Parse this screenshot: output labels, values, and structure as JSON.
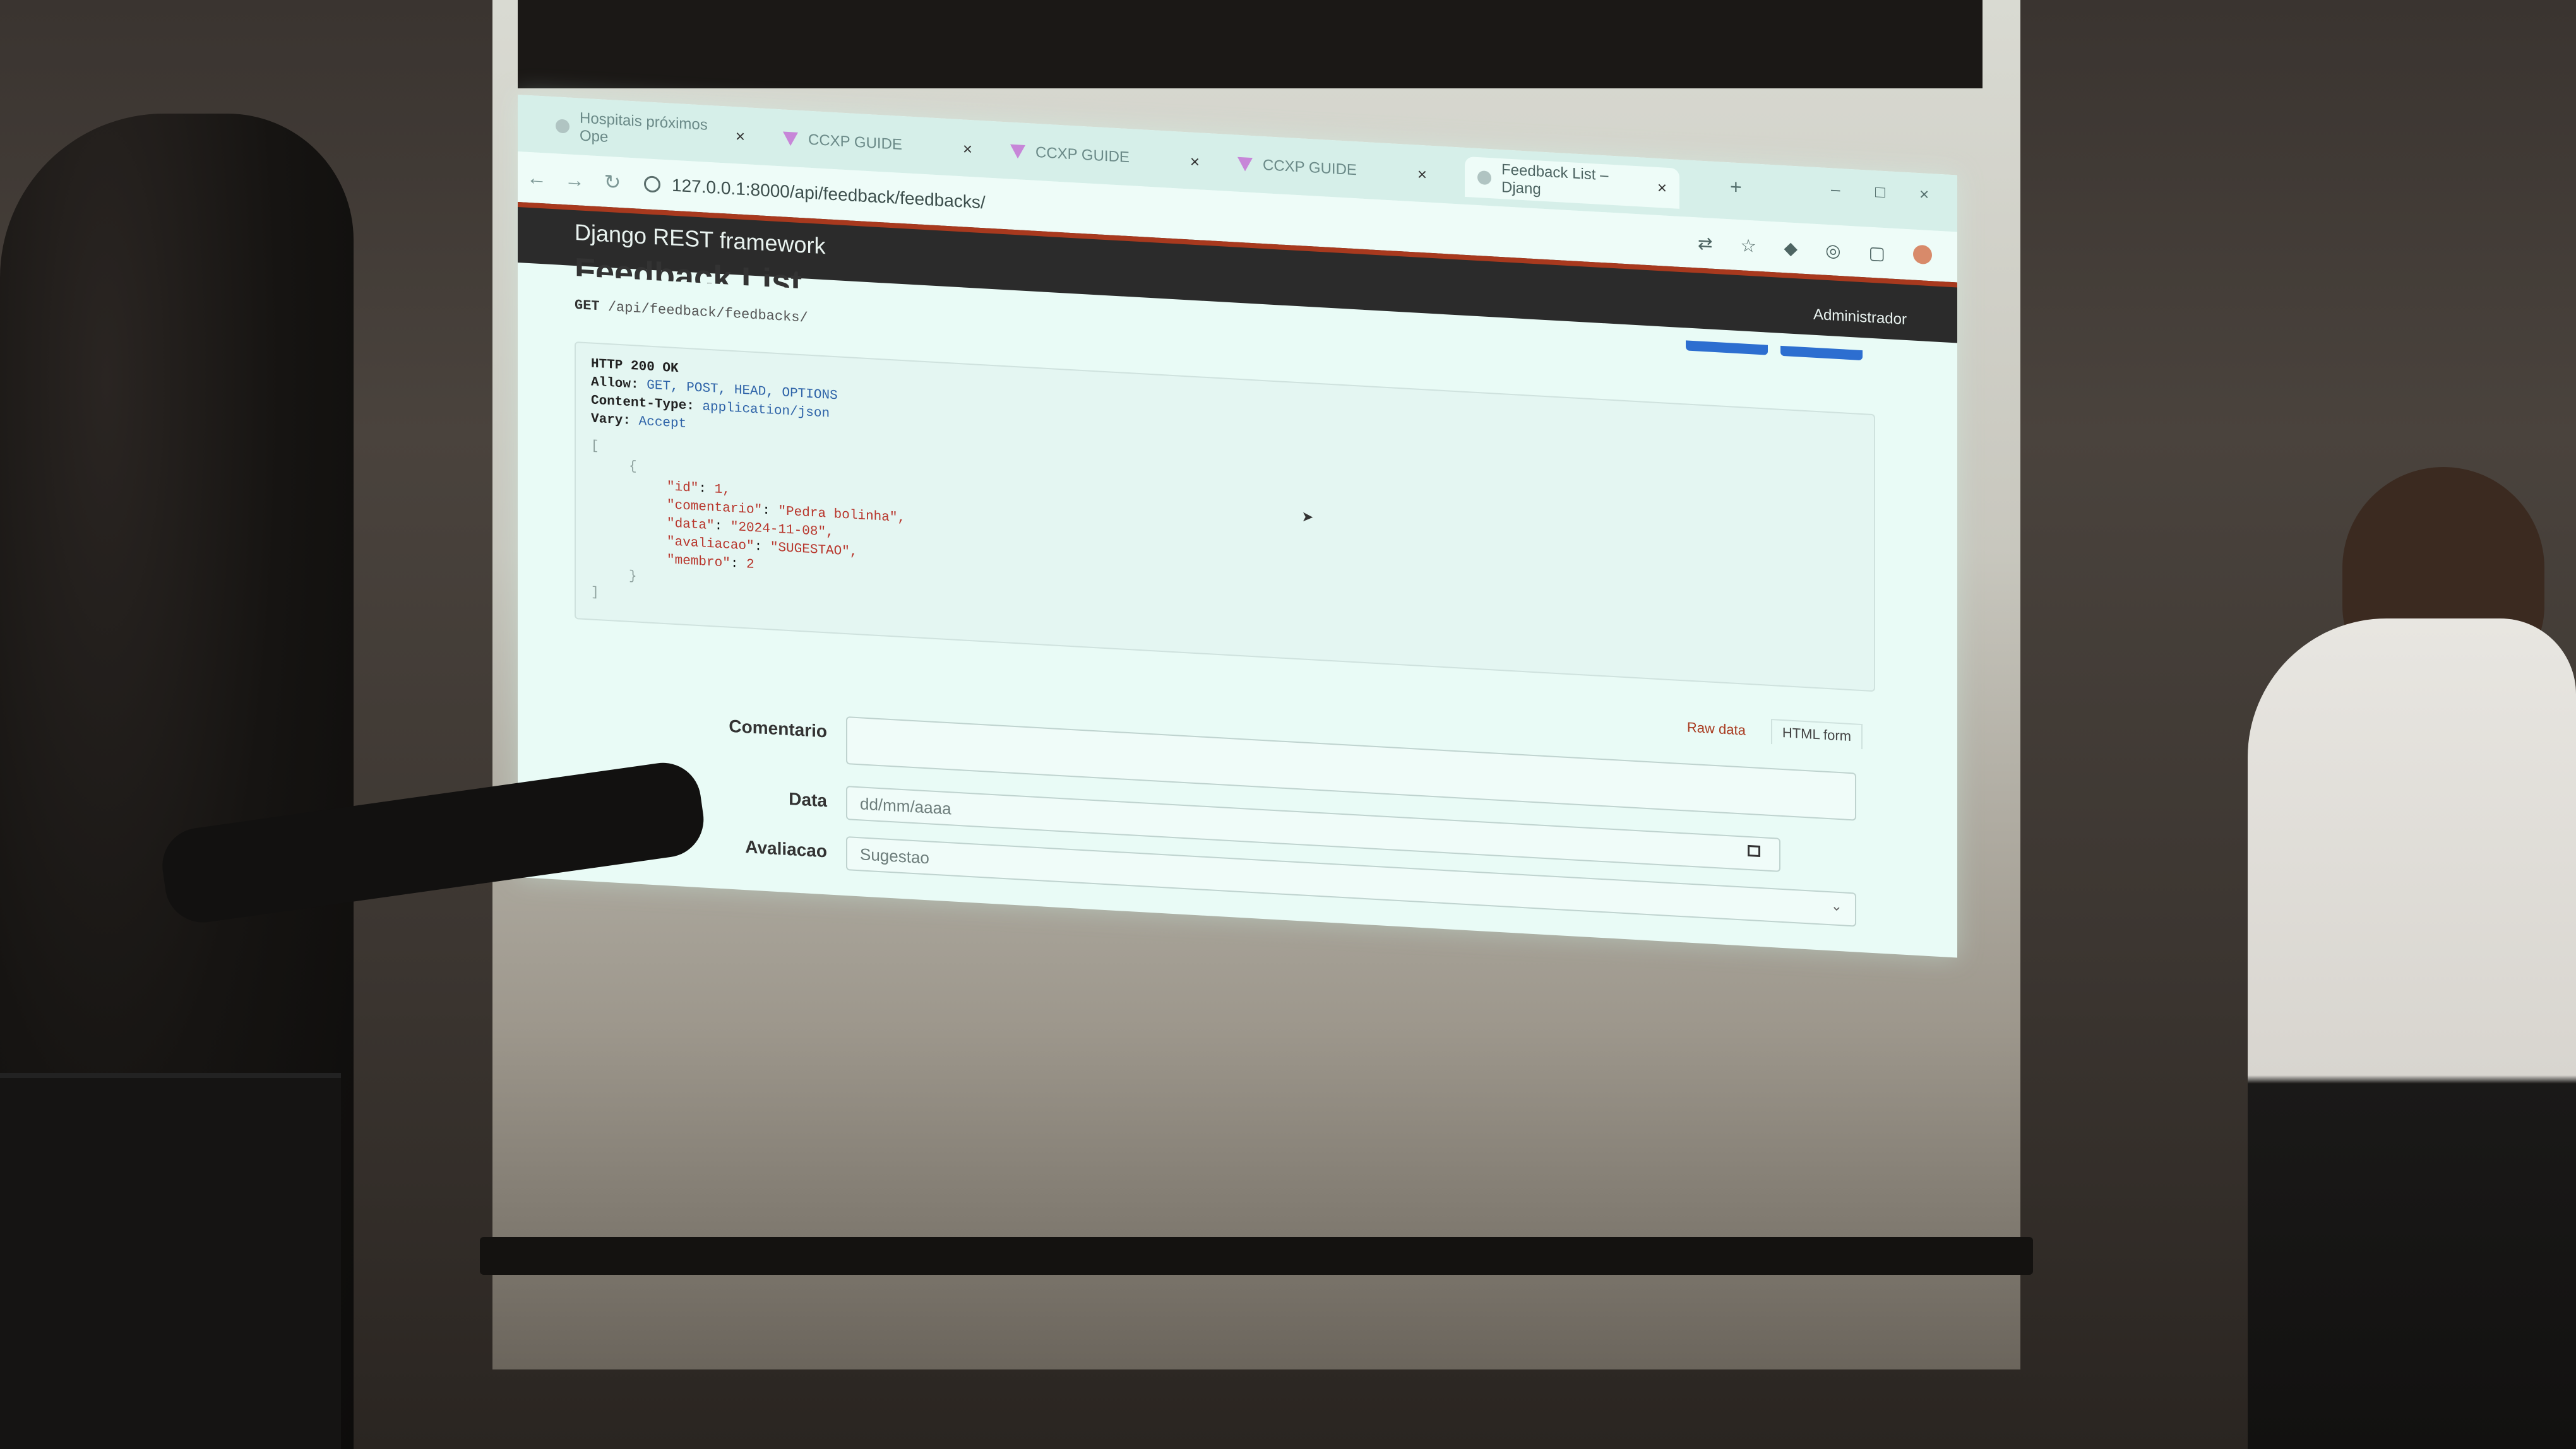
{
  "browser": {
    "tabs": [
      {
        "label": "Hospitais próximos Ope",
        "close": "×"
      },
      {
        "label": "CCXP GUIDE",
        "close": "×"
      },
      {
        "label": "CCXP GUIDE",
        "close": "×"
      },
      {
        "label": "CCXP GUIDE",
        "close": "×"
      },
      {
        "label": "Feedback List – Djang",
        "close": "×"
      }
    ],
    "new_tab": "+",
    "window_controls": {
      "minimize": "–",
      "maximize": "□",
      "close": "×"
    },
    "nav": {
      "back": "←",
      "forward": "→",
      "reload": "↻"
    },
    "url": "127.0.0.1:8000/api/feedback/feedbacks/"
  },
  "drf": {
    "brand": "Django REST framework",
    "user": "Administrador",
    "page_title": "Feedback List",
    "request": {
      "method": "GET",
      "path": "/api/feedback/feedbacks/"
    },
    "response": {
      "status": "HTTP 200 OK",
      "headers": [
        {
          "name": "Allow:",
          "value": "GET, POST, HEAD, OPTIONS"
        },
        {
          "name": "Content-Type:",
          "value": "application/json"
        },
        {
          "name": "Vary:",
          "value": "Accept"
        }
      ],
      "open_bracket": "[",
      "open_brace": "{",
      "fields": [
        {
          "key": "\"id\"",
          "value": "1,"
        },
        {
          "key": "\"comentario\"",
          "value": "\"Pedra bolinha\","
        },
        {
          "key": "\"data\"",
          "value": "\"2024-11-08\","
        },
        {
          "key": "\"avaliacao\"",
          "value": "\"SUGESTAO\","
        },
        {
          "key": "\"membro\"",
          "value": "2"
        }
      ],
      "close_brace": "}",
      "close_bracket": "]"
    },
    "format_tabs": {
      "raw": "Raw data",
      "html": "HTML form"
    },
    "form": {
      "comentario": {
        "label": "Comentario",
        "value": ""
      },
      "data": {
        "label": "Data",
        "placeholder": "dd/mm/aaaa"
      },
      "avaliacao": {
        "label": "Avaliacao",
        "value": "Sugestao"
      }
    }
  }
}
